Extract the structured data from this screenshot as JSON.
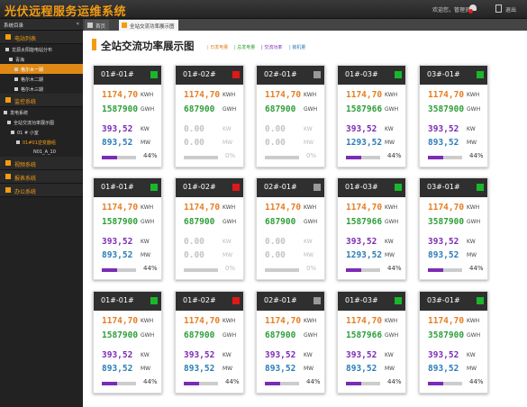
{
  "app": {
    "title": "光伏远程服务运维系统",
    "welcome": "欢迎您，管理员！",
    "exit_label": "退出"
  },
  "sidebar": {
    "title": "系统目录",
    "collapse": "«",
    "items": [
      {
        "kind": "sec",
        "label": "电站列表"
      },
      {
        "kind": "tree",
        "label": "龙源太阳能电站分布",
        "indent": 6,
        "mark": true
      },
      {
        "kind": "tree",
        "label": "青海",
        "indent": 10,
        "mark": true
      },
      {
        "kind": "tree",
        "label": "格尔木一期",
        "indent": 16,
        "mark": true,
        "state": "sel"
      },
      {
        "kind": "tree",
        "label": "格尔木二期",
        "indent": 16,
        "mark": true
      },
      {
        "kind": "tree",
        "label": "格尔木三期",
        "indent": 16,
        "mark": true
      },
      {
        "kind": "sec",
        "label": "监控系统"
      },
      {
        "kind": "tree",
        "label": "发电系统",
        "indent": 4,
        "mark": true
      },
      {
        "kind": "tree",
        "label": "全站交流功率展示图",
        "indent": 8,
        "mark": true
      },
      {
        "kind": "tree",
        "label": "01 # 小室",
        "indent": 12,
        "mark": true
      },
      {
        "kind": "tree",
        "label": "01#01逆变器组",
        "indent": 18,
        "mark": true,
        "state": "orange"
      },
      {
        "kind": "tree",
        "label": "N01_A_10",
        "indent": 30,
        "mark": false
      },
      {
        "kind": "sec",
        "label": "视频系统"
      },
      {
        "kind": "sec",
        "label": "报表系统"
      },
      {
        "kind": "sec",
        "label": "办公系统"
      }
    ]
  },
  "tabs": {
    "home": "首页",
    "active": "全站交流功率展示图"
  },
  "page": {
    "title": "全站交流功率展示图",
    "legend": [
      {
        "label": "日发电量",
        "color": "#e67e22"
      },
      {
        "label": "总发电量",
        "color": "#2e9e3a"
      },
      {
        "label": "交流功率",
        "color": "#7b2bb5"
      },
      {
        "label": "装机量",
        "color": "#2a7db5"
      }
    ]
  },
  "colors": {
    "ok": "#19b82a",
    "fault": "#e01818",
    "offline": "#999999",
    "day": "#e67e22",
    "total": "#2e9e3a",
    "power": "#7b2bb5",
    "capacity": "#2a7db5",
    "muted": "#c4c4c4"
  },
  "units": {
    "day": "KWH",
    "total": "GWH",
    "power": "KW",
    "capacity": "MW"
  },
  "cards": [
    {
      "name": "01#-01#",
      "status": "ok",
      "day": "1174,70",
      "total": "1587900",
      "power": "393,52",
      "capacity": "893,52",
      "percent": "44%",
      "fill": 0.44,
      "dim": false
    },
    {
      "name": "01#-02#",
      "status": "fault",
      "day": "1174,70",
      "total": "687900",
      "power": "0.00",
      "capacity": "0.00",
      "percent": "0%",
      "fill": 0,
      "dim": true
    },
    {
      "name": "02#-01#",
      "status": "offline",
      "day": "1174,70",
      "total": "687900",
      "power": "0.00",
      "capacity": "0.00",
      "percent": "0%",
      "fill": 0,
      "dim": true
    },
    {
      "name": "01#-03#",
      "status": "ok",
      "day": "1174,70",
      "total": "1587966",
      "power": "393,52",
      "capacity": "1293,52",
      "percent": "44%",
      "fill": 0.44,
      "dim": false
    },
    {
      "name": "03#-01#",
      "status": "ok",
      "day": "1174,70",
      "total": "3587900",
      "power": "393,52",
      "capacity": "893,52",
      "percent": "44%",
      "fill": 0.44,
      "dim": false
    },
    {
      "name": "01#-01#",
      "status": "ok",
      "day": "1174,70",
      "total": "1587900",
      "power": "393,52",
      "capacity": "893,52",
      "percent": "44%",
      "fill": 0.44,
      "dim": false
    },
    {
      "name": "01#-02#",
      "status": "fault",
      "day": "1174,70",
      "total": "687900",
      "power": "0.00",
      "capacity": "0.00",
      "percent": "0%",
      "fill": 0,
      "dim": true
    },
    {
      "name": "02#-01#",
      "status": "offline",
      "day": "1174,70",
      "total": "687900",
      "power": "0.00",
      "capacity": "0.00",
      "percent": "0%",
      "fill": 0,
      "dim": true
    },
    {
      "name": "01#-03#",
      "status": "ok",
      "day": "1174,70",
      "total": "1587966",
      "power": "393,52",
      "capacity": "1293,52",
      "percent": "44%",
      "fill": 0.44,
      "dim": false
    },
    {
      "name": "03#-01#",
      "status": "ok",
      "day": "1174,70",
      "total": "3587900",
      "power": "393,52",
      "capacity": "893,52",
      "percent": "44%",
      "fill": 0.44,
      "dim": false
    },
    {
      "name": "01#-01#",
      "status": "ok",
      "day": "1174,70",
      "total": "1587900",
      "power": "393,52",
      "capacity": "893,52",
      "percent": "44%",
      "fill": 0.44,
      "dim": false
    },
    {
      "name": "01#-02#",
      "status": "fault",
      "day": "1174,70",
      "total": "687900",
      "power": "393,52",
      "capacity": "893,52",
      "percent": "44%",
      "fill": 0.44,
      "dim": false
    },
    {
      "name": "02#-01#",
      "status": "offline",
      "day": "1174,70",
      "total": "687900",
      "power": "393,52",
      "capacity": "893,52",
      "percent": "44%",
      "fill": 0.44,
      "dim": false
    },
    {
      "name": "01#-03#",
      "status": "ok",
      "day": "1174,70",
      "total": "1587966",
      "power": "393,52",
      "capacity": "893,52",
      "percent": "44%",
      "fill": 0.44,
      "dim": false
    },
    {
      "name": "03#-01#",
      "status": "ok",
      "day": "1174,70",
      "total": "3587900",
      "power": "393,52",
      "capacity": "893,52",
      "percent": "44%",
      "fill": 0.44,
      "dim": false
    }
  ]
}
